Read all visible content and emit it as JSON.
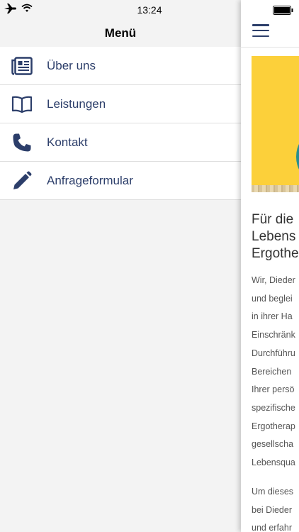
{
  "status_bar": {
    "time": "13:24"
  },
  "menu": {
    "title": "Menü",
    "items": [
      {
        "label": "Über uns",
        "icon": "newspaper-icon"
      },
      {
        "label": "Leistungen",
        "icon": "book-icon"
      },
      {
        "label": "Kontakt",
        "icon": "phone-icon"
      },
      {
        "label": "Anfrageformular",
        "icon": "pencil-icon"
      }
    ]
  },
  "content": {
    "heading_lines": [
      "Für die",
      "Lebens",
      "Ergothe"
    ],
    "paragraph1_lines": [
      "Wir, Dieder",
      "und beglei",
      "in ihrer Ha",
      "Einschränk",
      "Durchführu",
      "Bereichen",
      "Ihrer persö",
      "spezifische",
      "Ergotherap",
      "gesellscha",
      "Lebensqua"
    ],
    "paragraph2_lines": [
      "Um dieses",
      "bei Dieder",
      "und erfahr"
    ]
  },
  "colors": {
    "menu_text": "#2c3e6a",
    "hero_background": "#fcd03a",
    "hero_accent": "#2a8e8f"
  }
}
